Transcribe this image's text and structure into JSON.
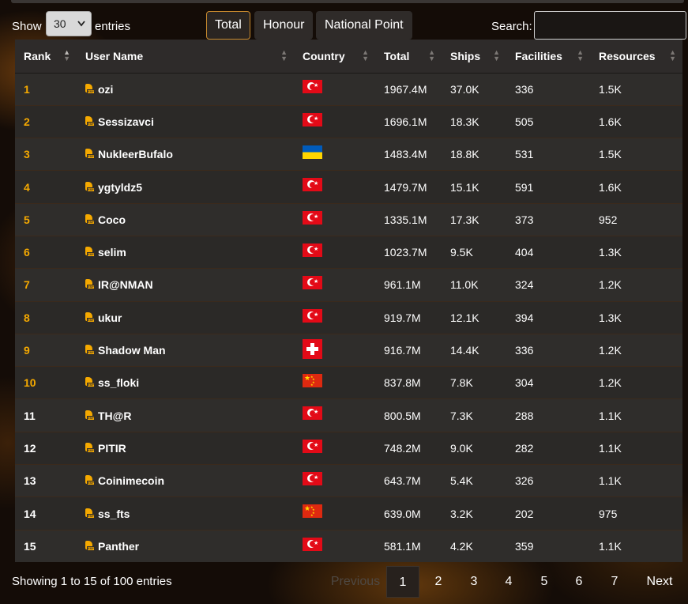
{
  "controls": {
    "show_label": "Show",
    "page_length": "30",
    "entries_label": "entries",
    "tabs": [
      {
        "label": "Total",
        "active": true
      },
      {
        "label": "Honour",
        "active": false
      },
      {
        "label": "National Point",
        "active": false
      }
    ],
    "search_label": "Search:",
    "search_value": ""
  },
  "table": {
    "columns": [
      "Rank",
      "User Name",
      "Country",
      "Total",
      "Ships",
      "Facilities",
      "Resources"
    ],
    "rows": [
      {
        "rank": "1",
        "name": "ozi",
        "country": "turkey-flag",
        "total": "1967.4M",
        "ships": "37.0K",
        "facilities": "336",
        "resources": "1.5K"
      },
      {
        "rank": "2",
        "name": "Sessizavci",
        "country": "turkey-flag",
        "total": "1696.1M",
        "ships": "18.3K",
        "facilities": "505",
        "resources": "1.6K"
      },
      {
        "rank": "3",
        "name": "NukleerBufalo",
        "country": "ukraine-flag",
        "total": "1483.4M",
        "ships": "18.8K",
        "facilities": "531",
        "resources": "1.5K"
      },
      {
        "rank": "4",
        "name": "ygtyldz5",
        "country": "turkey-flag",
        "total": "1479.7M",
        "ships": "15.1K",
        "facilities": "591",
        "resources": "1.6K"
      },
      {
        "rank": "5",
        "name": "Coco",
        "country": "turkey-flag",
        "total": "1335.1M",
        "ships": "17.3K",
        "facilities": "373",
        "resources": "952"
      },
      {
        "rank": "6",
        "name": "selim",
        "country": "turkey-flag",
        "total": "1023.7M",
        "ships": "9.5K",
        "facilities": "404",
        "resources": "1.3K"
      },
      {
        "rank": "7",
        "name": "IR@NMAN",
        "country": "turkey-flag",
        "total": "961.1M",
        "ships": "11.0K",
        "facilities": "324",
        "resources": "1.2K"
      },
      {
        "rank": "8",
        "name": "ukur",
        "country": "turkey-flag",
        "total": "919.7M",
        "ships": "12.1K",
        "facilities": "394",
        "resources": "1.3K"
      },
      {
        "rank": "9",
        "name": "Shadow Man",
        "country": "switzerland-flag",
        "total": "916.7M",
        "ships": "14.4K",
        "facilities": "336",
        "resources": "1.2K"
      },
      {
        "rank": "10",
        "name": "ss_floki",
        "country": "china-flag",
        "total": "837.8M",
        "ships": "7.8K",
        "facilities": "304",
        "resources": "1.2K"
      },
      {
        "rank": "11",
        "name": "TH@R",
        "country": "turkey-flag",
        "total": "800.5M",
        "ships": "7.3K",
        "facilities": "288",
        "resources": "1.1K"
      },
      {
        "rank": "12",
        "name": "PITIR",
        "country": "turkey-flag",
        "total": "748.2M",
        "ships": "9.0K",
        "facilities": "282",
        "resources": "1.1K"
      },
      {
        "rank": "13",
        "name": "Coinimecoin",
        "country": "turkey-flag",
        "total": "643.7M",
        "ships": "5.4K",
        "facilities": "326",
        "resources": "1.1K"
      },
      {
        "rank": "14",
        "name": "ss_fts",
        "country": "china-flag",
        "total": "639.0M",
        "ships": "3.2K",
        "facilities": "202",
        "resources": "975"
      },
      {
        "rank": "15",
        "name": "Panther",
        "country": "turkey-flag",
        "total": "581.1M",
        "ships": "4.2K",
        "facilities": "359",
        "resources": "1.1K"
      }
    ]
  },
  "footer": {
    "info": "Showing 1 to 15 of 100 entries",
    "previous": "Previous",
    "pages": [
      "1",
      "2",
      "3",
      "4",
      "5",
      "6",
      "7"
    ],
    "next": "Next"
  },
  "colors": {
    "rank_top": "#f5a900",
    "rank_rest": "#ffffff",
    "active_tab_border": "#c88a2e"
  }
}
